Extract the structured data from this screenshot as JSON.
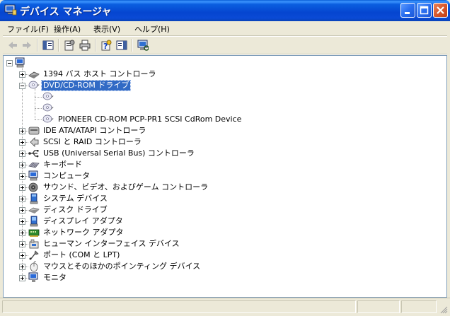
{
  "window": {
    "title": "デバイス マネージャ"
  },
  "menu": [
    {
      "label": "ファイル(F)"
    },
    {
      "label": "操作(A)"
    },
    {
      "label": "表示(V)"
    },
    {
      "label": "ヘルプ(H)"
    }
  ],
  "toolbar": {
    "items": [
      "back-arrow-icon",
      "forward-arrow-icon",
      "show-hide-console-tree-icon",
      "properties-icon",
      "print-icon",
      "help-icon",
      "show-hide-action-pane-icon",
      "scan-hardware-icon"
    ]
  },
  "tree": {
    "root_icon": "computer-icon",
    "nodes": [
      {
        "label": "1394 バス ホスト コントローラ",
        "icon": "bus-controller-icon",
        "expanded": false,
        "selected": false
      },
      {
        "label": "DVD/CD-ROM ドライブ",
        "icon": "cdrom-drive-icon",
        "expanded": true,
        "selected": true,
        "children": [
          {
            "label": "",
            "icon": "cdrom-drive-icon"
          },
          {
            "label": "",
            "icon": "cdrom-drive-icon"
          },
          {
            "label": "PIONEER CD-ROM PCP-PR1 SCSI CdRom Device",
            "icon": "cdrom-drive-icon"
          }
        ]
      },
      {
        "label": "IDE ATA/ATAPI コントローラ",
        "icon": "ide-controller-icon",
        "expanded": false,
        "selected": false
      },
      {
        "label": "SCSI と RAID コントローラ",
        "icon": "scsi-controller-icon",
        "expanded": false,
        "selected": false
      },
      {
        "label": "USB (Universal Serial Bus) コントローラ",
        "icon": "usb-icon",
        "expanded": false,
        "selected": false
      },
      {
        "label": "キーボード",
        "icon": "keyboard-icon",
        "expanded": false,
        "selected": false
      },
      {
        "label": "コンピュータ",
        "icon": "computer-icon",
        "expanded": false,
        "selected": false
      },
      {
        "label": "サウンド、ビデオ、およびゲーム コントローラ",
        "icon": "sound-video-icon",
        "expanded": false,
        "selected": false
      },
      {
        "label": "システム デバイス",
        "icon": "system-device-icon",
        "expanded": false,
        "selected": false
      },
      {
        "label": "ディスク ドライブ",
        "icon": "disk-drive-icon",
        "expanded": false,
        "selected": false
      },
      {
        "label": "ディスプレイ アダプタ",
        "icon": "display-adapter-icon",
        "expanded": false,
        "selected": false
      },
      {
        "label": "ネットワーク アダプタ",
        "icon": "network-adapter-icon",
        "expanded": false,
        "selected": false
      },
      {
        "label": "ヒューマン インターフェイス デバイス",
        "icon": "hid-icon",
        "expanded": false,
        "selected": false
      },
      {
        "label": "ポート (COM と LPT)",
        "icon": "port-icon",
        "expanded": false,
        "selected": false
      },
      {
        "label": "マウスとそのほかのポインティング デバイス",
        "icon": "mouse-icon",
        "expanded": false,
        "selected": false
      },
      {
        "label": "モニタ",
        "icon": "monitor-icon",
        "expanded": false,
        "selected": false
      }
    ]
  },
  "colors": {
    "titlebar": "#0a4ad6",
    "selection": "#316ac5",
    "chrome": "#ece9d8"
  }
}
